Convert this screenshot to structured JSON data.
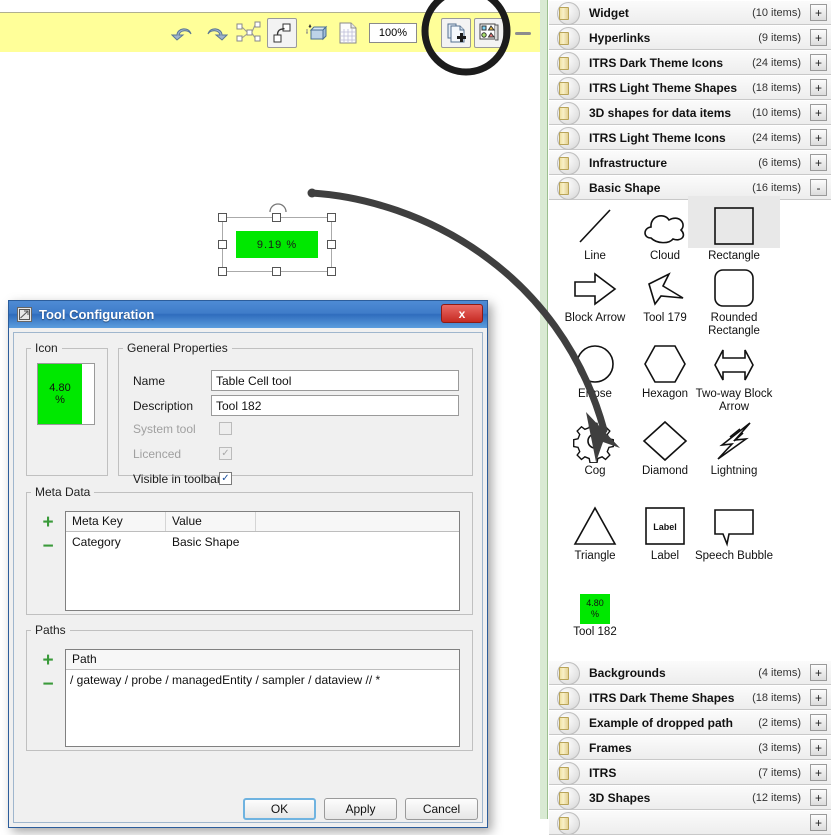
{
  "toolbar": {
    "icons": [
      {
        "name": "undo-icon",
        "glyph": "↶"
      },
      {
        "name": "redo-icon",
        "glyph": "↷"
      },
      {
        "name": "align-nodes-icon",
        "glyph": "∴"
      },
      {
        "name": "connector-icon",
        "glyph": "⤡"
      },
      {
        "name": "insert-3d-icon",
        "glyph": "▭"
      },
      {
        "name": "grid-page-icon",
        "glyph": "▦"
      }
    ],
    "zoom_value": "100%",
    "zoom_arrow": "▼",
    "new_tool_icon": "new-tool-button",
    "palette_icon": "shape-palette-button",
    "minimize_icon": "minimize-button"
  },
  "canvas": {
    "shape_text": "9.19 %",
    "shape_color": "#00e800"
  },
  "dialog": {
    "title": "Tool Configuration",
    "close_label": "x",
    "icon_group": {
      "legend": "Icon",
      "preview_value": "4.80",
      "preview_unit": "%"
    },
    "general": {
      "legend": "General Properties",
      "name_label": "Name",
      "name_value": "Table Cell tool",
      "description_label": "Description",
      "description_value": "Tool 182",
      "system_tool_label": "System tool",
      "system_tool_checked": "",
      "licenced_label": "Licenced",
      "licenced_checked": "✓",
      "visible_label": "Visible in toolbar",
      "visible_checked": "✓"
    },
    "meta": {
      "legend": "Meta Data",
      "add_label": "+",
      "remove_label": "−",
      "columns": [
        "Meta Key",
        "Value"
      ],
      "rows": [
        [
          "Category",
          "Basic Shape"
        ]
      ]
    },
    "paths": {
      "legend": "Paths",
      "add_label": "+",
      "remove_label": "−",
      "columns": [
        "Path"
      ],
      "rows": [
        "/ gateway / probe / managedEntity / sampler / dataview // *"
      ]
    },
    "buttons": {
      "ok": "OK",
      "apply": "Apply",
      "cancel": "Cancel"
    }
  },
  "panel": {
    "top_folders": [
      {
        "name": "Widget",
        "count": "(10 items)",
        "btn": "+"
      },
      {
        "name": "Hyperlinks",
        "count": "(9 items)",
        "btn": "+"
      },
      {
        "name": "ITRS Dark Theme Icons",
        "count": "(24 items)",
        "btn": "+"
      },
      {
        "name": "ITRS Light Theme Shapes",
        "count": "(18 items)",
        "btn": "+"
      },
      {
        "name": "3D shapes for data items",
        "count": "(10 items)",
        "btn": "+"
      },
      {
        "name": "ITRS Light Theme Icons",
        "count": "(24 items)",
        "btn": "+"
      },
      {
        "name": "Infrastructure",
        "count": "(6 items)",
        "btn": "+"
      },
      {
        "name": "Basic Shape",
        "count": "(16 items)",
        "btn": "-"
      }
    ],
    "shapes": [
      {
        "label": "Line",
        "icon": "line-shape",
        "selected": false
      },
      {
        "label": "Cloud",
        "icon": "cloud-shape",
        "selected": false
      },
      {
        "label": "Rectangle",
        "icon": "rectangle-shape",
        "selected": true
      },
      {
        "label": "Block Arrow",
        "icon": "block-arrow-shape",
        "selected": false
      },
      {
        "label": "Tool 179",
        "icon": "tool-179-shape",
        "selected": false
      },
      {
        "label": "Rounded Rectangle",
        "icon": "rounded-rectangle-shape",
        "selected": false
      },
      {
        "label": "Ellipse",
        "icon": "ellipse-shape",
        "selected": false
      },
      {
        "label": "Hexagon",
        "icon": "hexagon-shape",
        "selected": false
      },
      {
        "label": "Two-way Block Arrow",
        "icon": "two-way-block-arrow-shape",
        "selected": false
      },
      {
        "label": "Cog",
        "icon": "cog-shape",
        "selected": false
      },
      {
        "label": "Diamond",
        "icon": "diamond-shape",
        "selected": false
      },
      {
        "label": "Lightning",
        "icon": "lightning-shape",
        "selected": false
      },
      {
        "label": "Triangle",
        "icon": "triangle-shape",
        "selected": false
      },
      {
        "label": "Label",
        "icon": "label-shape",
        "selected": false
      },
      {
        "label": "Speech Bubble",
        "icon": "speech-bubble-shape",
        "selected": false
      },
      {
        "label": "Tool 182",
        "icon": "tool-182-shape",
        "selected": false
      }
    ],
    "label_shape_text": "Label",
    "tool182_value": "4.80",
    "tool182_unit": "%",
    "bottom_folders": [
      {
        "name": "Backgrounds",
        "count": "(4 items)",
        "btn": "+"
      },
      {
        "name": "ITRS Dark Theme Shapes",
        "count": "(18 items)",
        "btn": "+"
      },
      {
        "name": "Example of dropped path",
        "count": "(2 items)",
        "btn": "+"
      },
      {
        "name": "Frames",
        "count": "(3 items)",
        "btn": "+"
      },
      {
        "name": "ITRS",
        "count": "(7 items)",
        "btn": "+"
      },
      {
        "name": "3D Shapes",
        "count": "(12 items)",
        "btn": "+"
      }
    ]
  }
}
